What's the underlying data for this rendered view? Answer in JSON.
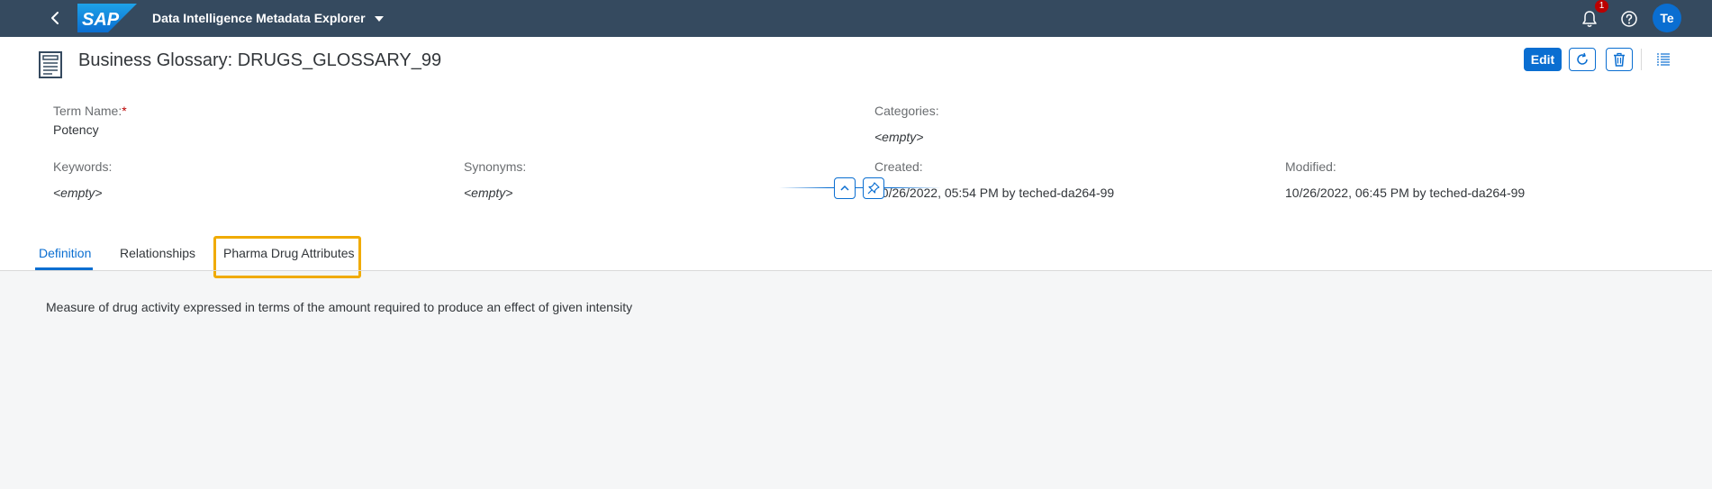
{
  "shell": {
    "logo_text": "SAP",
    "title": "Data Intelligence Metadata Explorer",
    "notification_count": "1",
    "avatar_initials": "Te",
    "icons": [
      "back-icon",
      "chevron-down-icon",
      "bell-icon",
      "help-icon"
    ]
  },
  "header": {
    "title": "Business Glossary: DRUGS_GLOSSARY_99",
    "edit_label": "Edit",
    "icons": [
      "glossary-document-icon",
      "refresh-icon",
      "delete-icon",
      "list-icon"
    ]
  },
  "fields": {
    "term_name": {
      "label": "Term Name:",
      "required_mark": "*",
      "value": "Potency"
    },
    "categories": {
      "label": "Categories:",
      "value": "<empty>"
    },
    "keywords": {
      "label": "Keywords:",
      "value": "<empty>"
    },
    "synonyms": {
      "label": "Synonyms:",
      "value": "<empty>"
    },
    "created": {
      "label": "Created:",
      "value": "10/26/2022, 05:54 PM by teched-da264-99"
    },
    "modified": {
      "label": "Modified:",
      "value": "10/26/2022, 06:45 PM by teched-da264-99"
    }
  },
  "tabs": [
    {
      "label": "Definition",
      "active": true
    },
    {
      "label": "Relationships",
      "active": false
    },
    {
      "label": "Pharma Drug Attributes",
      "active": false,
      "highlighted": true
    }
  ],
  "definition_text": "Measure of drug activity expressed in terms of the amount required to produce an effect of given intensity",
  "colors": {
    "shell_bg": "#354a5f",
    "accent": "#0a6ed1",
    "highlight": "#f0ab00",
    "badge": "#bb0000"
  }
}
